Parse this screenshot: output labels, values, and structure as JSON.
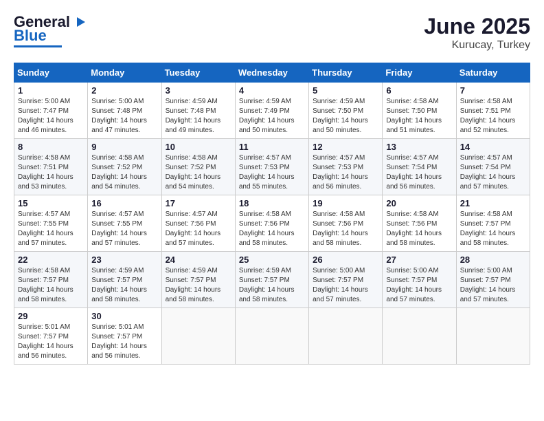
{
  "header": {
    "logo_line1": "General",
    "logo_line2": "Blue",
    "title": "June 2025",
    "subtitle": "Kurucay, Turkey"
  },
  "calendar": {
    "days_of_week": [
      "Sunday",
      "Monday",
      "Tuesday",
      "Wednesday",
      "Thursday",
      "Friday",
      "Saturday"
    ],
    "weeks": [
      [
        {
          "day": "",
          "info": ""
        },
        {
          "day": "2",
          "info": "Sunrise: 5:00 AM\nSunset: 7:48 PM\nDaylight: 14 hours\nand 47 minutes."
        },
        {
          "day": "3",
          "info": "Sunrise: 4:59 AM\nSunset: 7:48 PM\nDaylight: 14 hours\nand 49 minutes."
        },
        {
          "day": "4",
          "info": "Sunrise: 4:59 AM\nSunset: 7:49 PM\nDaylight: 14 hours\nand 50 minutes."
        },
        {
          "day": "5",
          "info": "Sunrise: 4:59 AM\nSunset: 7:50 PM\nDaylight: 14 hours\nand 50 minutes."
        },
        {
          "day": "6",
          "info": "Sunrise: 4:58 AM\nSunset: 7:50 PM\nDaylight: 14 hours\nand 51 minutes."
        },
        {
          "day": "7",
          "info": "Sunrise: 4:58 AM\nSunset: 7:51 PM\nDaylight: 14 hours\nand 52 minutes."
        }
      ],
      [
        {
          "day": "1",
          "info": "Sunrise: 5:00 AM\nSunset: 7:47 PM\nDaylight: 14 hours\nand 46 minutes."
        },
        {
          "day": "9",
          "info": "Sunrise: 4:58 AM\nSunset: 7:52 PM\nDaylight: 14 hours\nand 54 minutes."
        },
        {
          "day": "10",
          "info": "Sunrise: 4:58 AM\nSunset: 7:52 PM\nDaylight: 14 hours\nand 54 minutes."
        },
        {
          "day": "11",
          "info": "Sunrise: 4:57 AM\nSunset: 7:53 PM\nDaylight: 14 hours\nand 55 minutes."
        },
        {
          "day": "12",
          "info": "Sunrise: 4:57 AM\nSunset: 7:53 PM\nDaylight: 14 hours\nand 56 minutes."
        },
        {
          "day": "13",
          "info": "Sunrise: 4:57 AM\nSunset: 7:54 PM\nDaylight: 14 hours\nand 56 minutes."
        },
        {
          "day": "14",
          "info": "Sunrise: 4:57 AM\nSunset: 7:54 PM\nDaylight: 14 hours\nand 57 minutes."
        }
      ],
      [
        {
          "day": "8",
          "info": "Sunrise: 4:58 AM\nSunset: 7:51 PM\nDaylight: 14 hours\nand 53 minutes."
        },
        {
          "day": "16",
          "info": "Sunrise: 4:57 AM\nSunset: 7:55 PM\nDaylight: 14 hours\nand 57 minutes."
        },
        {
          "day": "17",
          "info": "Sunrise: 4:57 AM\nSunset: 7:56 PM\nDaylight: 14 hours\nand 57 minutes."
        },
        {
          "day": "18",
          "info": "Sunrise: 4:58 AM\nSunset: 7:56 PM\nDaylight: 14 hours\nand 58 minutes."
        },
        {
          "day": "19",
          "info": "Sunrise: 4:58 AM\nSunset: 7:56 PM\nDaylight: 14 hours\nand 58 minutes."
        },
        {
          "day": "20",
          "info": "Sunrise: 4:58 AM\nSunset: 7:56 PM\nDaylight: 14 hours\nand 58 minutes."
        },
        {
          "day": "21",
          "info": "Sunrise: 4:58 AM\nSunset: 7:57 PM\nDaylight: 14 hours\nand 58 minutes."
        }
      ],
      [
        {
          "day": "15",
          "info": "Sunrise: 4:57 AM\nSunset: 7:55 PM\nDaylight: 14 hours\nand 57 minutes."
        },
        {
          "day": "23",
          "info": "Sunrise: 4:59 AM\nSunset: 7:57 PM\nDaylight: 14 hours\nand 58 minutes."
        },
        {
          "day": "24",
          "info": "Sunrise: 4:59 AM\nSunset: 7:57 PM\nDaylight: 14 hours\nand 58 minutes."
        },
        {
          "day": "25",
          "info": "Sunrise: 4:59 AM\nSunset: 7:57 PM\nDaylight: 14 hours\nand 58 minutes."
        },
        {
          "day": "26",
          "info": "Sunrise: 5:00 AM\nSunset: 7:57 PM\nDaylight: 14 hours\nand 57 minutes."
        },
        {
          "day": "27",
          "info": "Sunrise: 5:00 AM\nSunset: 7:57 PM\nDaylight: 14 hours\nand 57 minutes."
        },
        {
          "day": "28",
          "info": "Sunrise: 5:00 AM\nSunset: 7:57 PM\nDaylight: 14 hours\nand 57 minutes."
        }
      ],
      [
        {
          "day": "22",
          "info": "Sunrise: 4:58 AM\nSunset: 7:57 PM\nDaylight: 14 hours\nand 58 minutes."
        },
        {
          "day": "30",
          "info": "Sunrise: 5:01 AM\nSunset: 7:57 PM\nDaylight: 14 hours\nand 56 minutes."
        },
        {
          "day": "",
          "info": ""
        },
        {
          "day": "",
          "info": ""
        },
        {
          "day": "",
          "info": ""
        },
        {
          "day": "",
          "info": ""
        },
        {
          "day": "",
          "info": ""
        }
      ],
      [
        {
          "day": "29",
          "info": "Sunrise: 5:01 AM\nSunset: 7:57 PM\nDaylight: 14 hours\nand 56 minutes."
        },
        {
          "day": "",
          "info": ""
        },
        {
          "day": "",
          "info": ""
        },
        {
          "day": "",
          "info": ""
        },
        {
          "day": "",
          "info": ""
        },
        {
          "day": "",
          "info": ""
        },
        {
          "day": "",
          "info": ""
        }
      ]
    ]
  }
}
